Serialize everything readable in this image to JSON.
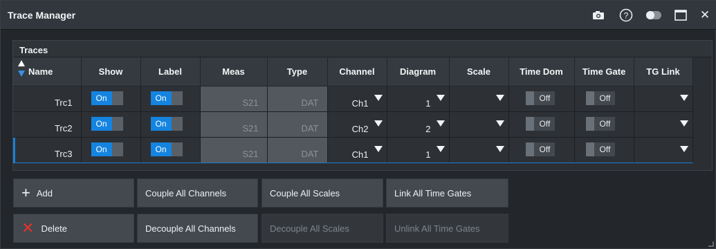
{
  "window": {
    "title": "Trace Manager",
    "icons": [
      "camera-icon",
      "help-icon",
      "toggle-icon",
      "maximize-icon",
      "close-icon"
    ],
    "close_glyph": "✕"
  },
  "panel": {
    "title": "Traces"
  },
  "table": {
    "headers": [
      "Name",
      "Show",
      "Label",
      "Meas",
      "Type",
      "Channel",
      "Diagram",
      "Scale",
      "Time Dom",
      "Time Gate",
      "TG Link"
    ],
    "rows": [
      {
        "name": "Trc1",
        "show": "On",
        "label": "On",
        "meas": "S21",
        "type": "DAT",
        "channel": "Ch1",
        "diagram": "1",
        "scale": "",
        "time_dom": "Off",
        "time_gate": "Off",
        "tg_link": ""
      },
      {
        "name": "Trc2",
        "show": "On",
        "label": "On",
        "meas": "S21",
        "type": "DAT",
        "channel": "Ch2",
        "diagram": "2",
        "scale": "",
        "time_dom": "Off",
        "time_gate": "Off",
        "tg_link": ""
      },
      {
        "name": "Trc3",
        "show": "On",
        "label": "On",
        "meas": "S21",
        "type": "DAT",
        "channel": "Ch1",
        "diagram": "1",
        "scale": "",
        "time_dom": "Off",
        "time_gate": "Off",
        "tg_link": ""
      }
    ],
    "selected_row": "Trc3"
  },
  "buttons": {
    "add": "Add",
    "delete": "Delete",
    "couple_all_channels": "Couple All Channels",
    "decouple_all_channels": "Decouple All Channels",
    "couple_all_scales": "Couple All Scales",
    "decouple_all_scales": "Decouple All Scales",
    "link_all_time_gates": "Link All Time Gates",
    "unlink_all_time_gates": "Unlink All Time Gates"
  },
  "colors": {
    "accent": "#1584e0",
    "delete_icon": "#e2352b",
    "disabled_text": "#7f848a"
  }
}
